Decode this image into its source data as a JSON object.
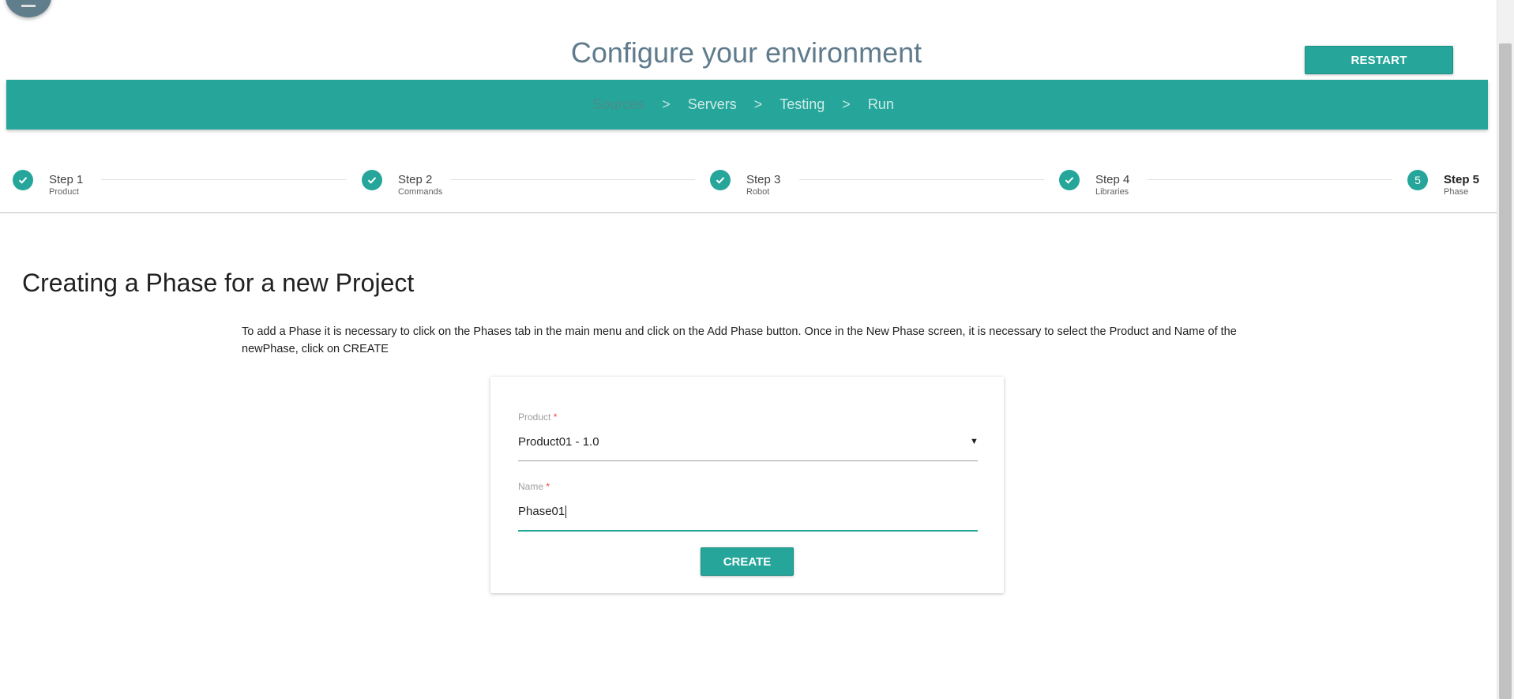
{
  "header": {
    "title": "Configure your environment",
    "restart_label": "RESTART"
  },
  "nav": {
    "items": [
      {
        "label": "Sources",
        "active": false
      },
      {
        "label": "Servers",
        "active": true
      },
      {
        "label": "Testing",
        "active": true
      },
      {
        "label": "Run",
        "active": true
      }
    ],
    "separator": ">"
  },
  "stepper": {
    "steps": [
      {
        "title": "Step 1",
        "subtitle": "Product",
        "status": "done",
        "icon": "check-icon"
      },
      {
        "title": "Step 2",
        "subtitle": "Commands",
        "status": "done",
        "icon": "check-icon"
      },
      {
        "title": "Step 3",
        "subtitle": "Robot",
        "status": "done",
        "icon": "check-icon"
      },
      {
        "title": "Step 4",
        "subtitle": "Libraries",
        "status": "done",
        "icon": "check-icon"
      },
      {
        "title": "Step 5",
        "subtitle": "Phase",
        "status": "active",
        "number": "5"
      }
    ]
  },
  "main": {
    "heading": "Creating a Phase for a new Project",
    "description": "To add a Phase it is necessary to click on the Phases tab in the main menu and click on the Add Phase button. Once in the New Phase screen, it is necessary to select the Product and Name of the newPhase, click on CREATE"
  },
  "form": {
    "product_label": "Product",
    "product_value": "Product01 - 1.0",
    "name_label": "Name",
    "name_value": "Phase01",
    "required_mark": "*",
    "dropdown_icon": "▼",
    "create_label": "CREATE"
  },
  "colors": {
    "accent": "#26a69a",
    "title": "#5f7b8c",
    "fab": "#607d8b",
    "required": "#f44336"
  }
}
